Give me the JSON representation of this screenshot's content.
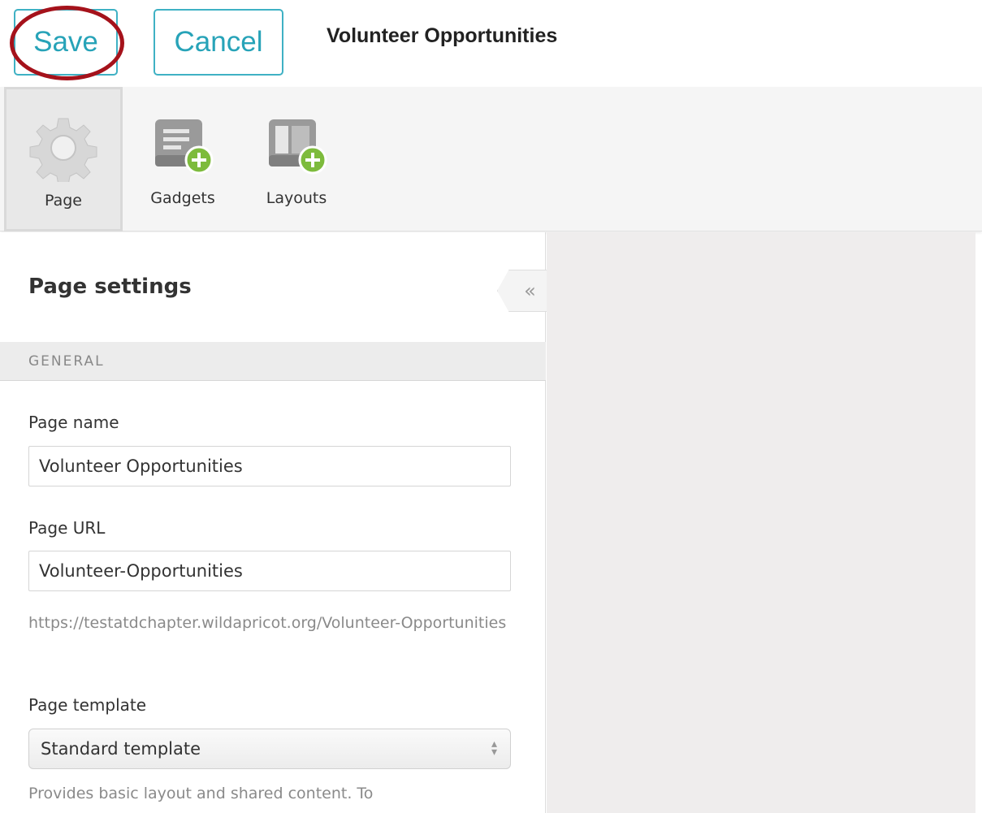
{
  "header": {
    "save_label": "Save",
    "cancel_label": "Cancel",
    "page_title": "Volunteer Opportunities"
  },
  "toolbar": {
    "tools": [
      {
        "label": "Page",
        "icon": "gear-icon",
        "active": true
      },
      {
        "label": "Gadgets",
        "icon": "add-gadget-icon",
        "active": false
      },
      {
        "label": "Layouts",
        "icon": "add-layout-icon",
        "active": false
      }
    ]
  },
  "panel": {
    "heading": "Page settings",
    "collapse_glyph": "«",
    "section": "GENERAL",
    "page_name_label": "Page name",
    "page_name_value": "Volunteer Opportunities",
    "page_url_label": "Page URL",
    "page_url_value": "Volunteer-Opportunities",
    "url_hint": "https://testatdchapter.wildapricot.org/Volunteer-Opportunities",
    "template_label": "Page template",
    "template_value": "Standard template",
    "template_hint": "Provides basic layout and shared content. To"
  },
  "colors": {
    "accent": "#27a3b8",
    "highlight": "#a5121b",
    "plus_green": "#7dbb3c"
  }
}
